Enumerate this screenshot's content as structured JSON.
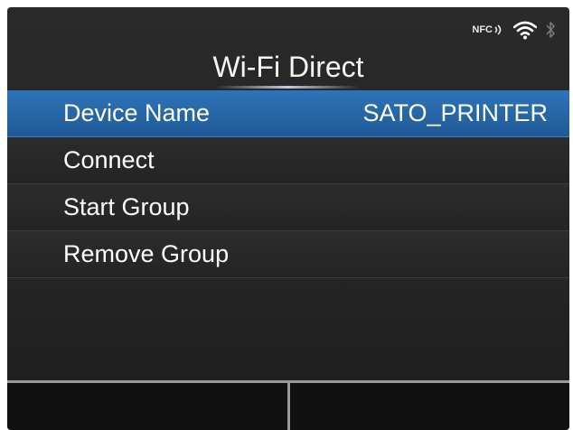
{
  "header": {
    "title": "Wi-Fi Direct",
    "nfc_label": "NFC",
    "icons": [
      "nfc-icon",
      "wifi-icon",
      "bluetooth-icon"
    ]
  },
  "menu": {
    "items": [
      {
        "label": "Device Name",
        "value": "SATO_PRINTER",
        "selected": true
      },
      {
        "label": "Connect"
      },
      {
        "label": "Start Group"
      },
      {
        "label": "Remove Group"
      }
    ]
  },
  "colors": {
    "selected_row": "#2f74b8",
    "background": "#242424",
    "softkey_border": "#9a9a9a"
  }
}
